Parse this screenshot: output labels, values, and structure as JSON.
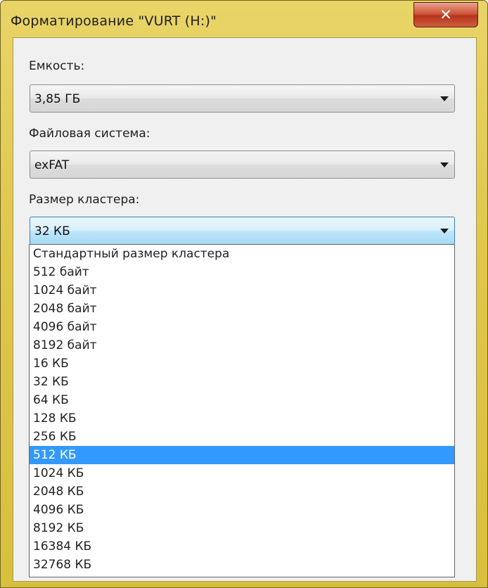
{
  "window": {
    "title": "Форматирование \"VURT (H:)\"",
    "close_icon": "✕"
  },
  "capacity": {
    "label": "Емкость:",
    "value": "3,85 ГБ"
  },
  "filesystem": {
    "label": "Файловая система:",
    "value": "exFAT"
  },
  "cluster": {
    "label": "Размер кластера:",
    "value": "32 КБ",
    "options": [
      "Стандартный размер кластера",
      "512 байт",
      "1024 байт",
      "2048 байт",
      "4096 байт",
      "8192 байт",
      "16 КБ",
      "32 КБ",
      "64 КБ",
      "128 КБ",
      "256 КБ",
      "512 КБ",
      "1024 КБ",
      "2048 КБ",
      "4096 КБ",
      "8192 КБ",
      "16384 КБ",
      "32768 КБ"
    ],
    "highlighted": "512 КБ"
  },
  "colors": {
    "frame": "#dfc64a",
    "close": "#c7452a",
    "highlight": "#3399ff"
  }
}
